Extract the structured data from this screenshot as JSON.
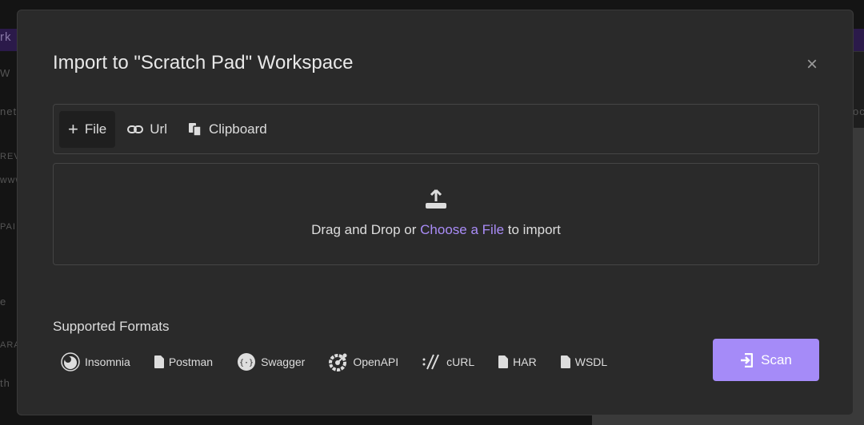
{
  "background": {
    "fragments": [
      "rk",
      "W",
      "nete",
      "REV",
      "www",
      "PAI",
      "e",
      "ARA",
      "th",
      "oc"
    ]
  },
  "modal": {
    "title": "Import to \"Scratch Pad\" Workspace",
    "close_icon": "×",
    "tabs": [
      {
        "label": "File",
        "icon": "plus-icon",
        "active": true
      },
      {
        "label": "Url",
        "icon": "link-icon"
      },
      {
        "label": "Clipboard",
        "icon": "clipboard-icon"
      }
    ],
    "drop": {
      "prefix": "Drag and Drop or ",
      "link": "Choose a File",
      "suffix": " to import",
      "icon": "upload-icon"
    },
    "supported_label": "Supported Formats",
    "formats": [
      {
        "label": "Insomnia",
        "icon": "insomnia-icon"
      },
      {
        "label": "Postman",
        "icon": "file-icon"
      },
      {
        "label": "Swagger",
        "icon": "swagger-icon"
      },
      {
        "label": "OpenAPI",
        "icon": "openapi-icon"
      },
      {
        "label": "cURL",
        "icon": "curl-icon"
      },
      {
        "label": "HAR",
        "icon": "file-icon"
      },
      {
        "label": "WSDL",
        "icon": "file-icon"
      }
    ],
    "scan_label": "Scan",
    "accent": "#a58bf8"
  }
}
